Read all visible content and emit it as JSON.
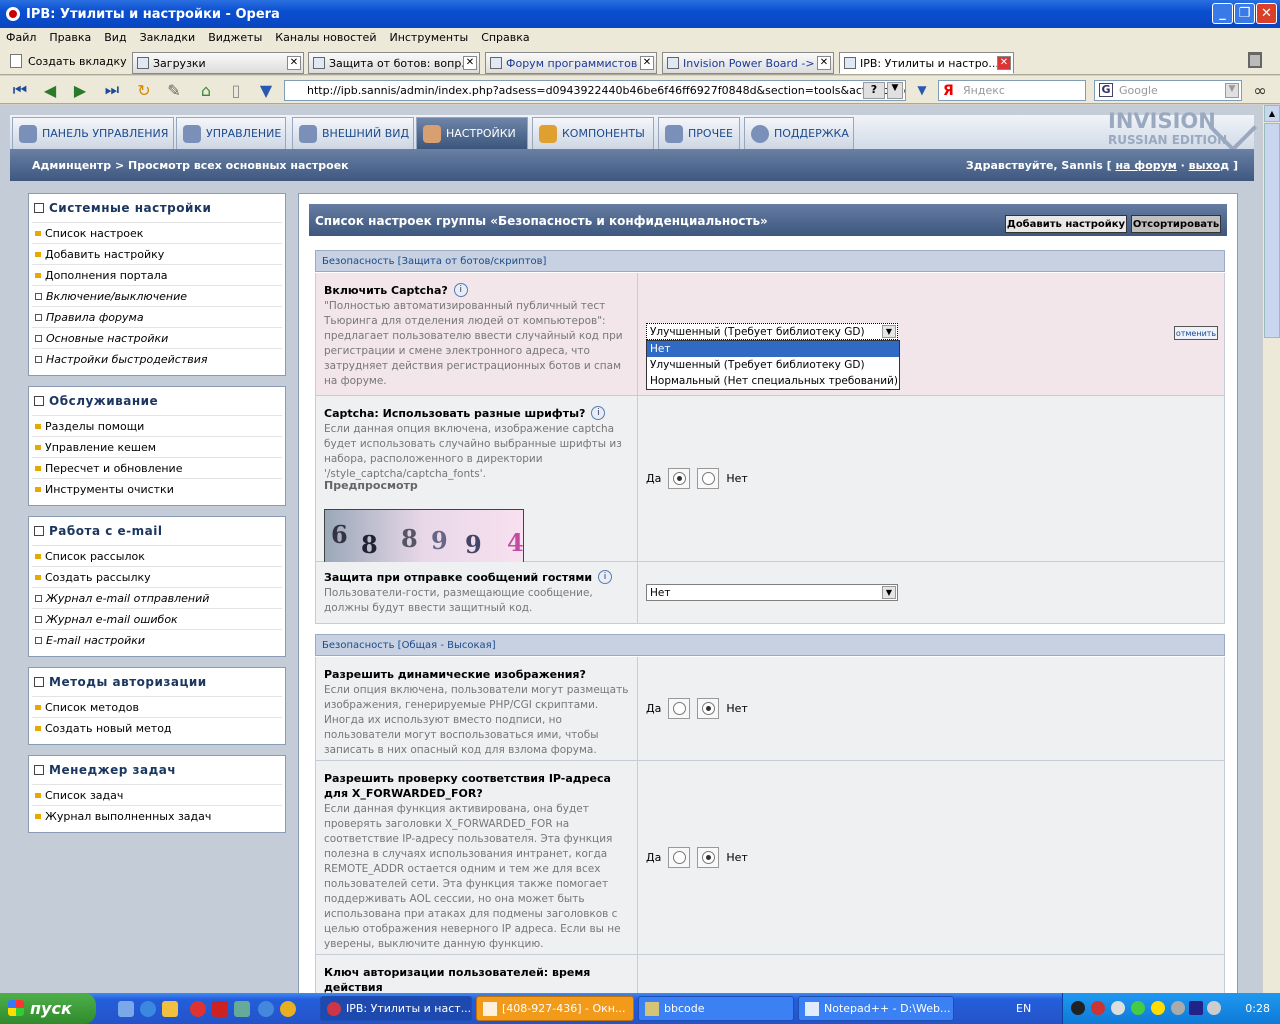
{
  "window": {
    "title": "IPB: Утилиты и настройки - Opera"
  },
  "menu": [
    "Файл",
    "Правка",
    "Вид",
    "Закладки",
    "Виджеты",
    "Каналы новостей",
    "Инструменты",
    "Справка"
  ],
  "tabs": {
    "new_tab": "Создать вкладку",
    "items": [
      {
        "label": "Загрузки"
      },
      {
        "label": "Защита от ботов: вопр..."
      },
      {
        "label": "Форум программистов S..."
      },
      {
        "label": "Invision Power Board -> ..."
      },
      {
        "label": "IPB: Утилиты и настро..."
      }
    ]
  },
  "address": {
    "url": "http://ipb.sannis/admin/index.php?adsess=d0943922440b46be6f46ff6927f0848d&section=tools&act=op&code=se",
    "q": "?"
  },
  "search": {
    "yandex_placeholder": "Яндекс",
    "google_placeholder": "Google"
  },
  "nav": {
    "tabs": [
      "ПАНЕЛЬ УПРАВЛЕНИЯ",
      "УПРАВЛЕНИЕ",
      "ВНЕШНИЙ ВИД",
      "НАСТРОЙКИ",
      "КОМПОНЕНТЫ",
      "ПРОЧЕЕ",
      "ПОДДЕРЖКА"
    ],
    "logo_big": "INVISION",
    "logo_small": "RUSSIAN EDITION"
  },
  "breadcrumb": {
    "path": "Админцентр > Просмотр всех основных настроек",
    "greeting": "Здравствуйте, Sannis [",
    "link_forum": "на форум",
    "sep": "·",
    "link_logout": "выход",
    "close": "]"
  },
  "sidebar": {
    "groups": [
      {
        "title": "Системные настройки",
        "items": [
          {
            "label": "Список настроек",
            "type": "bullet"
          },
          {
            "label": "Добавить настройку",
            "type": "bullet"
          },
          {
            "label": "Дополнения портала",
            "type": "bullet"
          },
          {
            "label": "Включение/выключение",
            "type": "check"
          },
          {
            "label": "Правила форума",
            "type": "check"
          },
          {
            "label": "Основные настройки",
            "type": "check"
          },
          {
            "label": "Настройки быстродействия",
            "type": "check"
          }
        ]
      },
      {
        "title": "Обслуживание",
        "items": [
          {
            "label": "Разделы помощи",
            "type": "bullet"
          },
          {
            "label": "Управление кешем",
            "type": "bullet"
          },
          {
            "label": "Пересчет и обновление",
            "type": "bullet"
          },
          {
            "label": "Инструменты очистки",
            "type": "bullet"
          }
        ]
      },
      {
        "title": "Работа с e-mail",
        "items": [
          {
            "label": "Список рассылок",
            "type": "bullet"
          },
          {
            "label": "Создать рассылку",
            "type": "bullet"
          },
          {
            "label": "Журнал e-mail отправлений",
            "type": "check"
          },
          {
            "label": "Журнал e-mail ошибок",
            "type": "check"
          },
          {
            "label": "E-mail настройки",
            "type": "check"
          }
        ]
      },
      {
        "title": "Методы авторизации",
        "items": [
          {
            "label": "Список методов",
            "type": "bullet"
          },
          {
            "label": "Создать новый метод",
            "type": "bullet"
          }
        ]
      },
      {
        "title": "Менеджер задач",
        "items": [
          {
            "label": "Список задач",
            "type": "bullet"
          },
          {
            "label": "Журнал выполненных задач",
            "type": "bullet"
          }
        ]
      }
    ]
  },
  "main": {
    "title": "Список настроек группы «Безопасность и конфиденциальность»",
    "add_button": "Добавить настройку",
    "sort_button": "Отсортировать",
    "section1": "Безопасность [Защита от ботов/скриптов]",
    "section2": "Безопасность [Общая - Высокая]",
    "yes": "Да",
    "no": "Нет",
    "info": "i",
    "captcha": {
      "title": "Включить Captcha?",
      "desc": "\"Полностью автоматизированный публичный тест Тьюринга для отделения людей от компьютеров\": предлагает пользователю ввести случайный код при регистрации и смене электронного адреса, что затрудняет действия регистрационных ботов и спам на форуме.",
      "selected": "Улучшенный (Требует библиотеку GD)",
      "options": [
        "Нет",
        "Улучшенный (Требует библиотеку GD)",
        "Нормальный (Нет специальных требований)"
      ],
      "cancel": "отменить"
    },
    "fonts": {
      "title": "Captcha: Использовать разные шрифты?",
      "desc": "Если данная опция включена, изображение captcha будет использовать случайно выбранные шрифты из набора, расположенного в директории '/style_captcha/captcha_fonts'.",
      "preview_label": "Предпросмотр",
      "preview_digits": [
        "6",
        "8",
        "8",
        "9",
        "9",
        "4"
      ]
    },
    "guest": {
      "title": "Защита при отправке сообщений гостями",
      "desc": "Пользователи-гости, размещающие сообщение, должны будут ввести защитный код.",
      "selected": "Нет"
    },
    "dynimg": {
      "title": "Разрешить динамические изображения?",
      "desc": "Если опция включена, пользователи могут размещать изображения, генерируемые PHP/CGI скриптами. Иногда их используют вместо подписи, но пользователи могут воспользоваться ими, чтобы записать в них опасный код для взлома форума."
    },
    "xff": {
      "title": "Разрешить проверку соответствия IP-адреса для X_FORWARDED_FOR?",
      "desc": "Если данная функция активирована, она будет проверять заголовки X_FORWARDED_FOR на соответствие IP-адресу пользователя. Эта функция полезна в случаях использования интранет, когда REMOTE_ADDR остается одним и тем же для всех пользователей сети. Эта функция также помогает поддерживать AOL сессии, но она может быть использована при атаках для подмены заголовков с целью отображения неверного IP адреса. Если вы не уверены, выключите данную функцию."
    },
    "authkey": {
      "title": "Ключ авторизации пользователей: время действия"
    }
  },
  "taskbar": {
    "start": "пуск",
    "items": [
      {
        "label": "IPB: Утилиты и наст..."
      },
      {
        "label": "[408-927-436] - Окн..."
      },
      {
        "label": "bbcode"
      },
      {
        "label": "Notepad++ - D:\\Web..."
      }
    ],
    "lang": "EN",
    "clock": "0:28"
  }
}
